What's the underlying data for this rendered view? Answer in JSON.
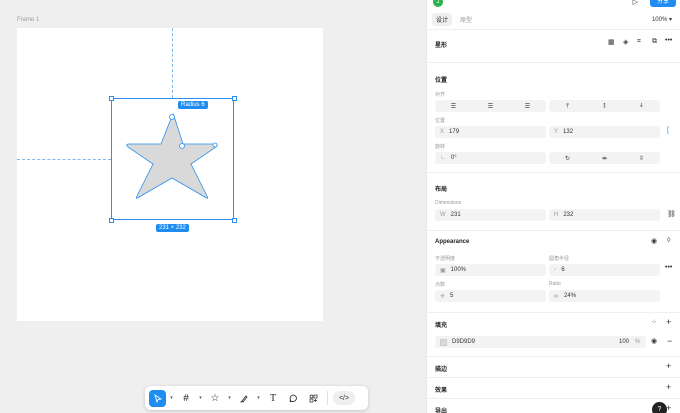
{
  "canvas": {
    "frame_label": "Frame 1",
    "radius_badge": "Radius 6",
    "dims_badge": "231 × 232"
  },
  "toolbar": {
    "code_label": "</>"
  },
  "panel": {
    "avatar_letter": "J",
    "share_label": "分享",
    "tabs": [
      {
        "label": "设计"
      },
      {
        "label": "原型"
      }
    ],
    "zoom": "100%",
    "shape": {
      "title": "星形"
    },
    "position": {
      "title": "位置",
      "align_label": "对齐",
      "pos_label": "位置",
      "x_prefix": "X",
      "x_value": "179",
      "y_prefix": "Y",
      "y_value": "132",
      "rotation_label": "旋转",
      "rotation_value": "0°"
    },
    "layout": {
      "title": "布局",
      "dimensions_label": "Dimensions",
      "w_prefix": "W",
      "w_value": "231",
      "h_prefix": "H",
      "h_value": "232"
    },
    "appearance": {
      "title": "Appearance",
      "opacity_label": "不透明度",
      "opacity_value": "100%",
      "corner_label": "圆角半径",
      "corner_value": "6",
      "points_label": "点数",
      "points_value": "5",
      "ratio_label": "Ratio",
      "ratio_value": "24%"
    },
    "fill": {
      "title": "填充",
      "hex": "D9D9D9",
      "opacity": "100",
      "unit": "%",
      "swatch_color": "#D9D9D9"
    },
    "stroke": {
      "title": "描边"
    },
    "effects": {
      "title": "效果"
    },
    "export": {
      "title": "导出"
    },
    "help_label": "?"
  },
  "colors": {
    "accent": "#1e8cf0",
    "star_fill": "#D9D9D9"
  }
}
